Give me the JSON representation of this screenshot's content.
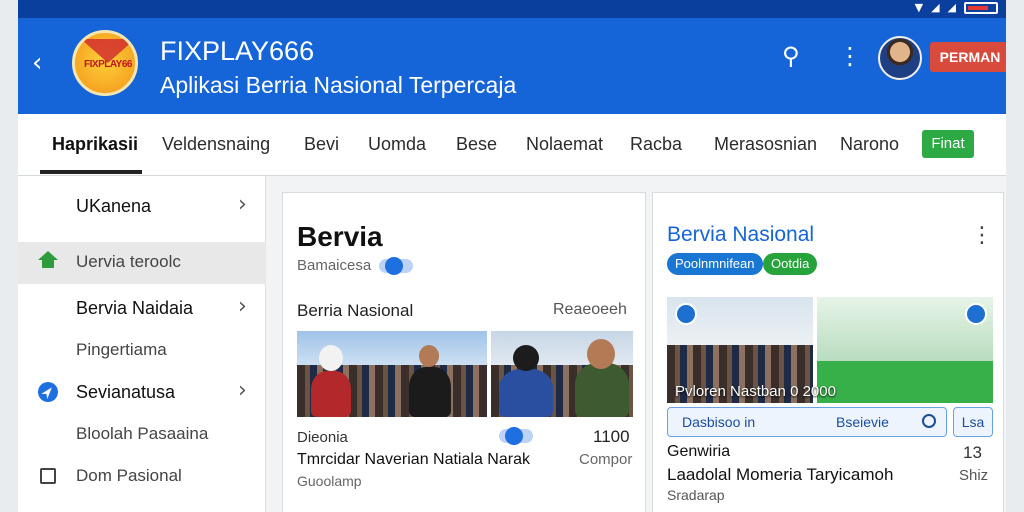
{
  "statusbar": {
    "signal": "▼",
    "wifi": "◢",
    "cell": "◢"
  },
  "header": {
    "back_glyph": "‹",
    "logo_text": "FIXPLAY66",
    "title": "FIXPLAY666",
    "subtitle": "Aplikasi Berria Nasional Terpercaja",
    "search_glyph": "⚲",
    "more_glyph": "⋮",
    "cta_label": "PERMAN"
  },
  "tabs": [
    {
      "label": "Haprikasii",
      "active": true
    },
    {
      "label": "Veldensnaing"
    },
    {
      "label": "Bevi"
    },
    {
      "label": "Uomda"
    },
    {
      "label": "Bese"
    },
    {
      "label": "Nolaemat"
    },
    {
      "label": "Racba"
    },
    {
      "label": "Merasosnian"
    },
    {
      "label": "Narono"
    }
  ],
  "tab_chip": "Finat",
  "sidebar": {
    "items": [
      {
        "label": "UKanena",
        "chevron": "›"
      },
      {
        "label": "Uervia teroolc",
        "icon": "home-icon"
      },
      {
        "label": "Bervia Naidaia",
        "chevron": "›"
      },
      {
        "label": "Pingertiama"
      },
      {
        "label": "Sevianatusa",
        "chevron": "›",
        "icon": "compass-icon"
      },
      {
        "label": "Bloolah Pasaaina"
      },
      {
        "label": "Dom Pasional",
        "icon": "square-icon"
      }
    ]
  },
  "card1": {
    "title": "Bervia",
    "subtitle": "Bamaicesa",
    "section_title": "Berria Nasional",
    "section_meta": "Reaeoeeh",
    "story": {
      "category": "Dieonia",
      "headline": "Tmrcidar  Naverian Natiala Narak",
      "source": "Guoolamp",
      "count": "1100",
      "count_label": "Compor"
    }
  },
  "card2": {
    "title": "Bervia Nasional",
    "more_glyph": "⋮",
    "chips": [
      "Poolnmnifean",
      "Ootdia"
    ],
    "image_caption": "Pvloren  Nastban 0 2000",
    "searchbar_text": "Dasbisoo in",
    "searchbar_right": "Bseievie",
    "side_button": "Lsa",
    "story": {
      "category": "Genwiria",
      "headline": "Laadolal Momeria Taryicamoh",
      "source": "Sradarap",
      "count": "13",
      "count_label": "Shiz"
    }
  }
}
